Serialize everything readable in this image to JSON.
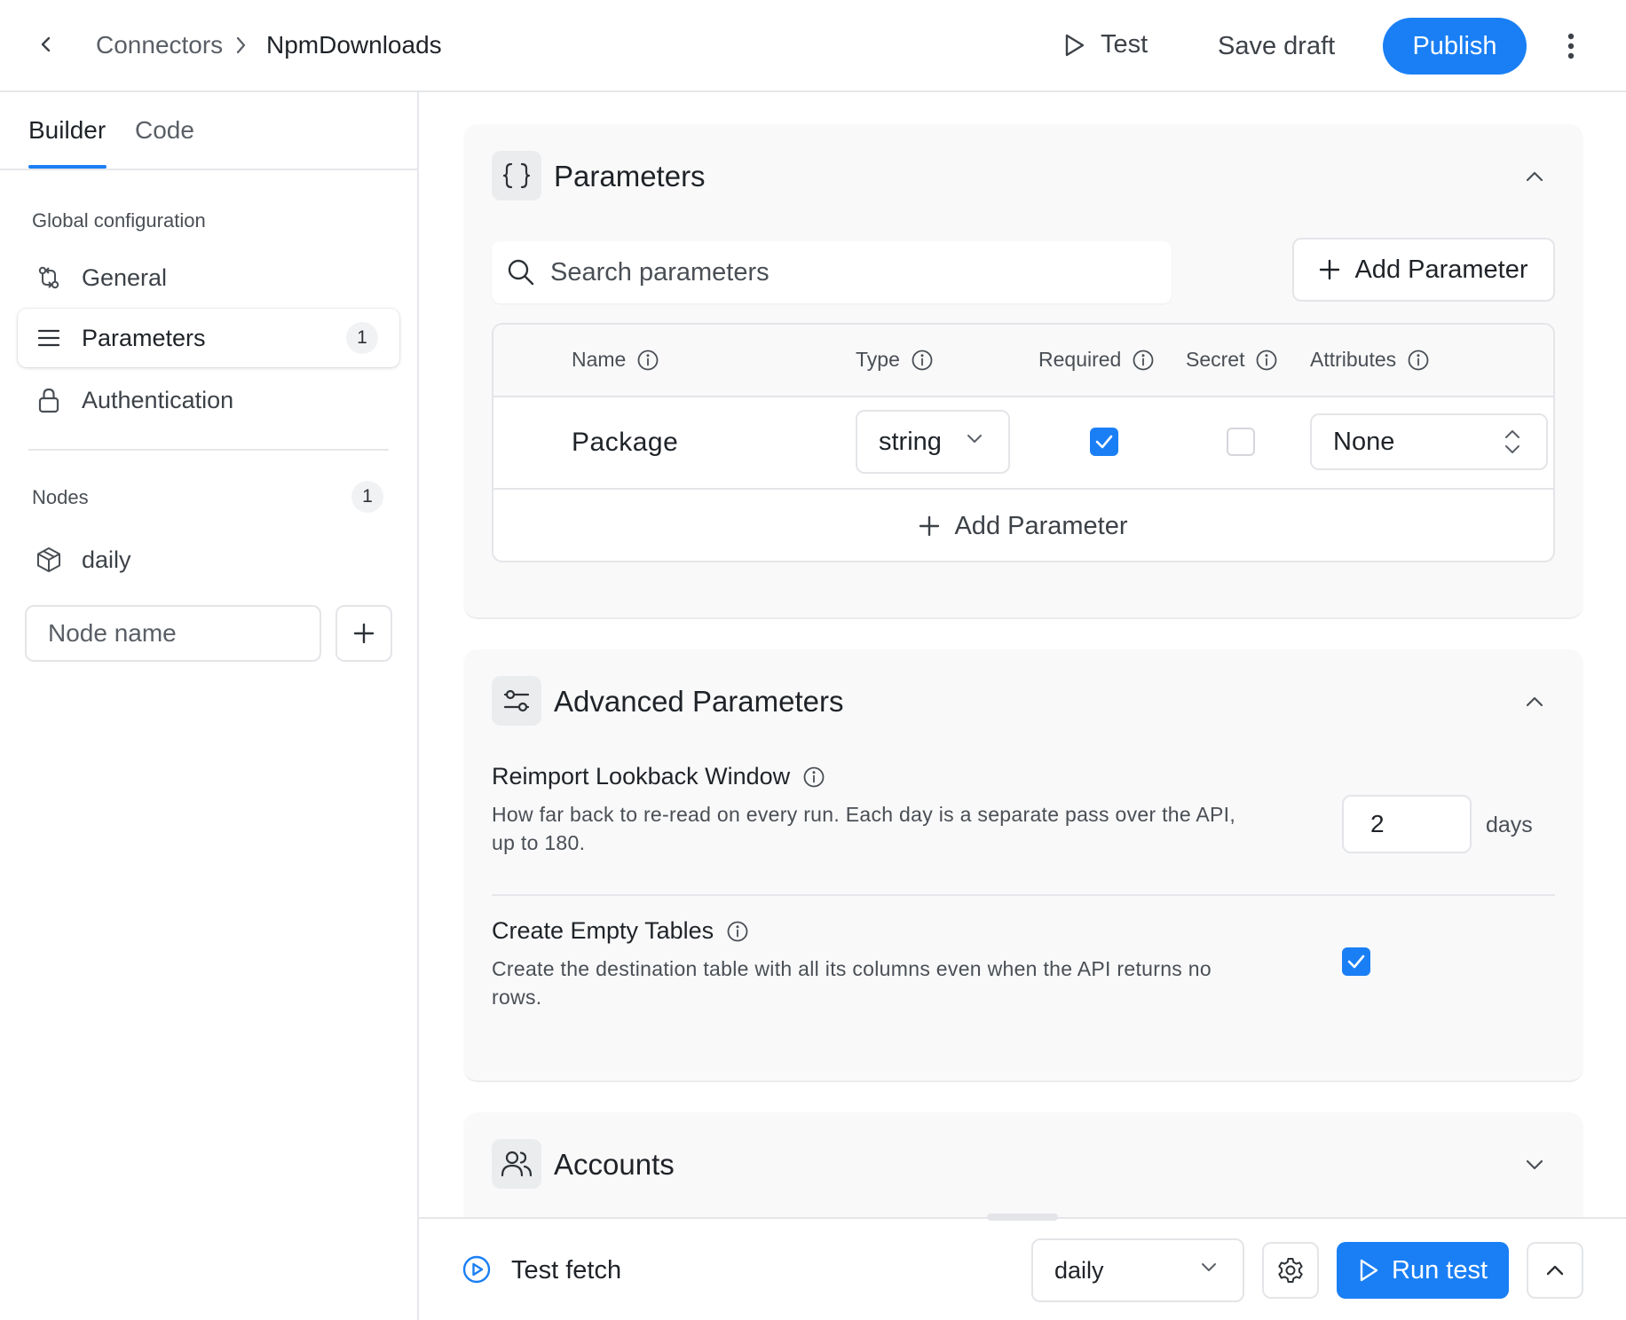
{
  "header": {
    "breadcrumb": [
      "Connectors",
      "NpmDownloads"
    ],
    "test_label": "Test",
    "save_label": "Save draft",
    "publish_label": "Publish"
  },
  "sidebar": {
    "tabs": [
      {
        "label": "Builder",
        "active": true
      },
      {
        "label": "Code",
        "active": false
      }
    ],
    "global_label": "Global configuration",
    "items": [
      {
        "label": "General",
        "icon": "git-compare-icon"
      },
      {
        "label": "Parameters",
        "icon": "list-icon",
        "count": "1",
        "active": true
      },
      {
        "label": "Authentication",
        "icon": "lock-icon"
      }
    ],
    "nodes_label": "Nodes",
    "nodes_count": "1",
    "nodes": [
      {
        "label": "daily",
        "icon": "cube-icon"
      }
    ],
    "node_name_placeholder": "Node name"
  },
  "parameters": {
    "title": "Parameters",
    "search_placeholder": "Search parameters",
    "add_label": "Add Parameter",
    "columns": [
      "Name",
      "Type",
      "Required",
      "Secret",
      "Attributes"
    ],
    "rows": [
      {
        "name": "Package",
        "type": "string",
        "required": true,
        "secret": false,
        "attributes": "None"
      }
    ],
    "footer_add_label": "Add Parameter"
  },
  "advanced": {
    "title": "Advanced Parameters",
    "lookback": {
      "title": "Reimport Lookback Window",
      "desc_line1": "How far back to re-read on every run. Each day is a separate pass over the API,",
      "desc_line2": "up to 180.",
      "value": "2",
      "unit": "days"
    },
    "empty_tables": {
      "title": "Create Empty Tables",
      "desc_line1": "Create the destination table with all its columns even when the API returns no",
      "desc_line2": "rows.",
      "checked": true
    }
  },
  "accounts": {
    "title": "Accounts"
  },
  "bottom": {
    "title": "Test fetch",
    "node_value": "daily",
    "run_label": "Run test"
  },
  "colors": {
    "accent": "#1a7ff5",
    "border": "#e3e5e8",
    "card_bg": "#f9f9fa"
  }
}
